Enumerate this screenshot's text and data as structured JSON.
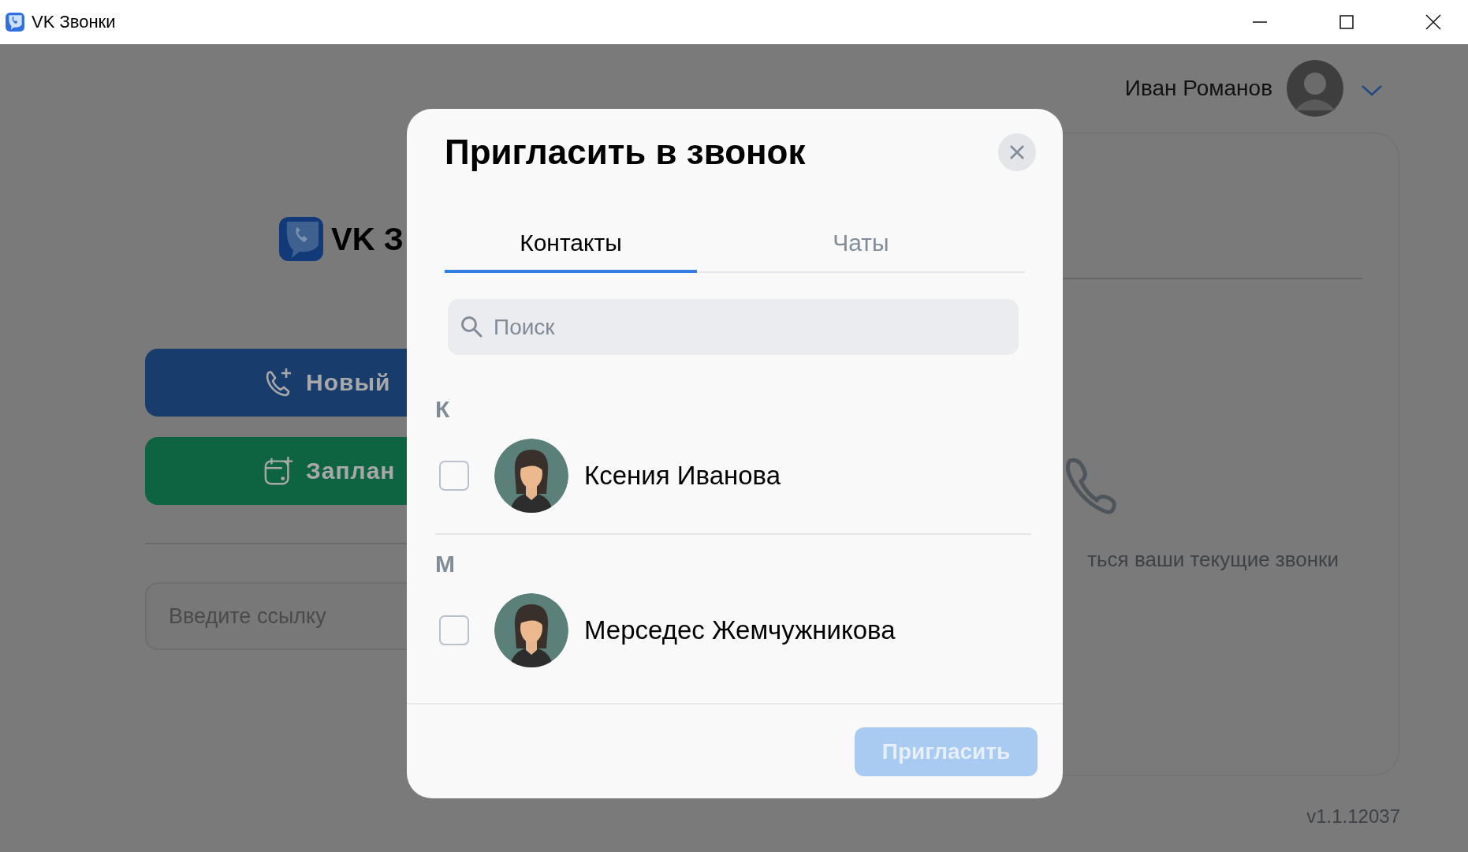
{
  "window": {
    "title": "VK Звонки"
  },
  "user": {
    "name": "Иван Романов"
  },
  "home": {
    "logo_text": "VK З",
    "buttons": [
      {
        "kind": "new_call",
        "label": "Новый"
      },
      {
        "kind": "schedule",
        "label": "Заплан"
      }
    ],
    "link_input": {
      "placeholder": "Введите ссылку"
    }
  },
  "calls_panel": {
    "empty_text": "ться ваши текущие звонки"
  },
  "version": "v1.1.12037",
  "dialog": {
    "title": "Пригласить в звонок",
    "tabs": [
      {
        "label": "Контакты",
        "selected": true
      },
      {
        "label": "Чаты",
        "selected": false
      }
    ],
    "search": {
      "placeholder": "Поиск"
    },
    "sections": [
      {
        "letter": "К",
        "contacts": [
          {
            "name": "Ксения Иванова",
            "checked": false
          }
        ]
      },
      {
        "letter": "М",
        "contacts": [
          {
            "name": "Мерседес Жемчужникова",
            "checked": false
          }
        ]
      }
    ],
    "invite_button": {
      "label": "Пригласить",
      "disabled": true
    }
  }
}
